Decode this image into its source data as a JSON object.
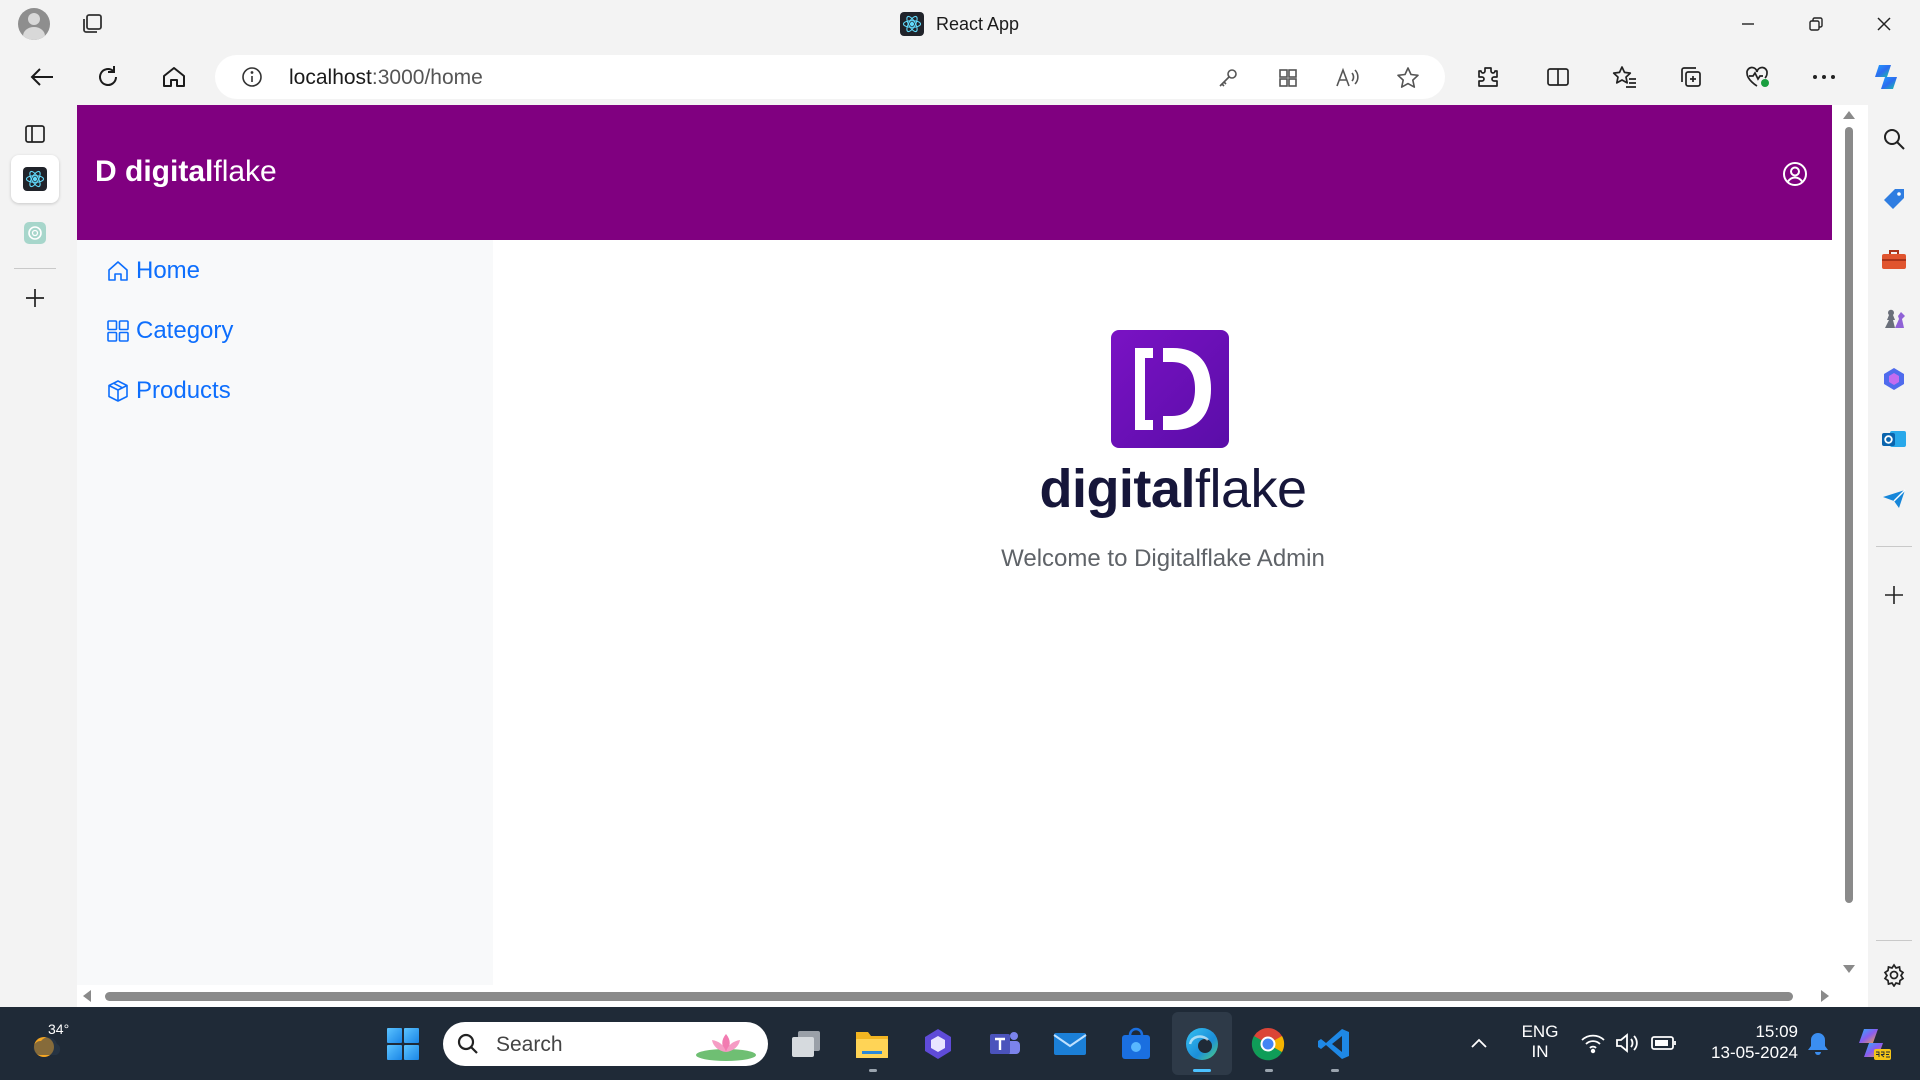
{
  "browser": {
    "window_title": "React App",
    "url_host": "localhost",
    "url_rest": ":3000/home"
  },
  "app": {
    "brand_prefix": "D",
    "brand_bold": "digital",
    "brand_light": "flake",
    "nav": [
      {
        "label": "Home",
        "icon": "home-icon"
      },
      {
        "label": "Category",
        "icon": "grid-icon"
      },
      {
        "label": "Products",
        "icon": "box-icon"
      }
    ],
    "logo_bold": "digital",
    "logo_light": "flake",
    "welcome": "Welcome to Digitalflake Admin",
    "header_color": "#800080",
    "link_color": "#0d6efd"
  },
  "taskbar": {
    "weather_temp": "34°",
    "search_placeholder": "Search",
    "lang_line1": "ENG",
    "lang_line2": "IN",
    "time": "15:09",
    "date": "13-05-2024"
  }
}
